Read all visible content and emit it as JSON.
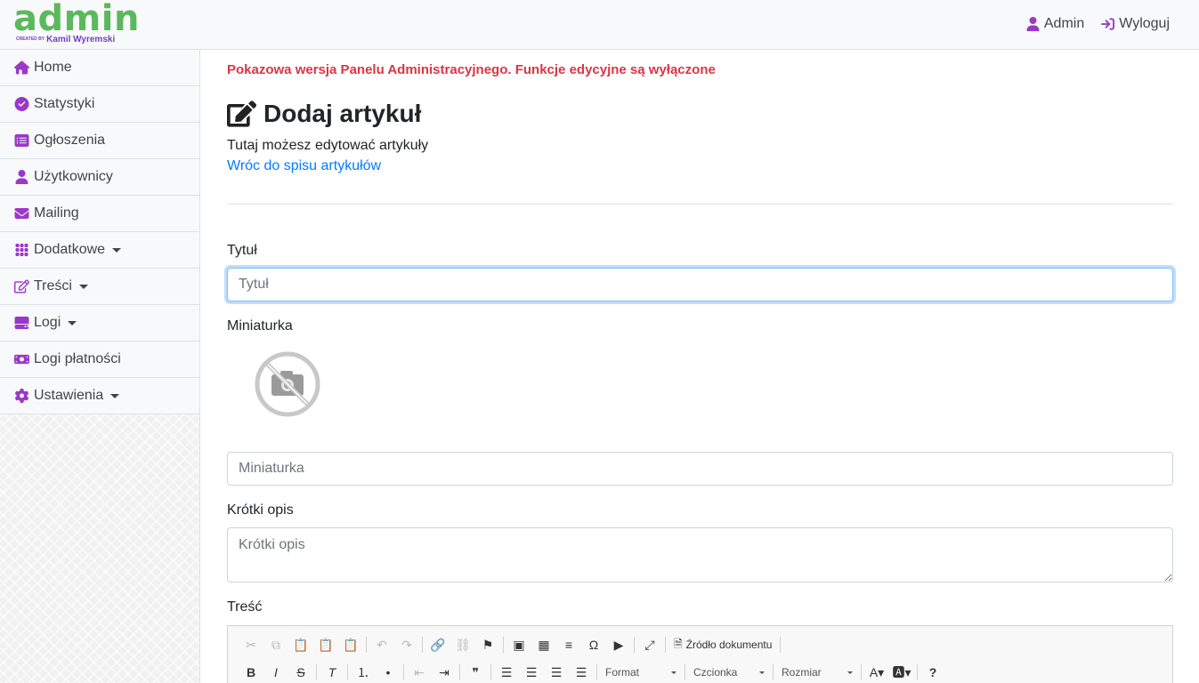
{
  "brand": {
    "logo_text": "admin",
    "created_by_small": "CREATED BY",
    "created_by_name": "Kamil Wyremski"
  },
  "topnav": {
    "user_label": "Admin",
    "logout_label": "Wyloguj"
  },
  "sidebar": {
    "items": [
      {
        "label": "Home",
        "icon": "home-icon"
      },
      {
        "label": "Statystyki",
        "icon": "check-circle-icon"
      },
      {
        "label": "Ogłoszenia",
        "icon": "list-icon"
      },
      {
        "label": "Użytkownicy",
        "icon": "user-icon"
      },
      {
        "label": "Mailing",
        "icon": "envelope-icon"
      },
      {
        "label": "Dodatkowe",
        "icon": "grid-icon",
        "dropdown": true
      },
      {
        "label": "Treści",
        "icon": "edit-icon",
        "dropdown": true
      },
      {
        "label": "Logi",
        "icon": "hdd-icon",
        "dropdown": true
      },
      {
        "label": "Logi płatności",
        "icon": "money-icon"
      },
      {
        "label": "Ustawienia",
        "icon": "gear-icon",
        "dropdown": true
      }
    ]
  },
  "main": {
    "notice": "Pokazowa wersja Panelu Administracyjnego. Funkcje edycyjne są wyłączone",
    "title": "Dodaj artykuł",
    "subtitle": "Tutaj możesz edytować artykuły",
    "back_link": "Wróc do spisu artykułów"
  },
  "form": {
    "title_label": "Tytuł",
    "title_placeholder": "Tytuł",
    "thumb_label": "Miniaturka",
    "thumb_placeholder": "Miniaturka",
    "desc_label": "Krótki opis",
    "desc_placeholder": "Krótki opis",
    "content_label": "Treść"
  },
  "editor": {
    "source_label": "Źródło dokumentu",
    "format_label": "Format",
    "font_label": "Czcionka",
    "size_label": "Rozmiar"
  },
  "colors": {
    "accent": "#9b38c7",
    "logo_green": "#5cb85c",
    "notice_red": "#dc3545",
    "link_blue": "#007bff"
  }
}
